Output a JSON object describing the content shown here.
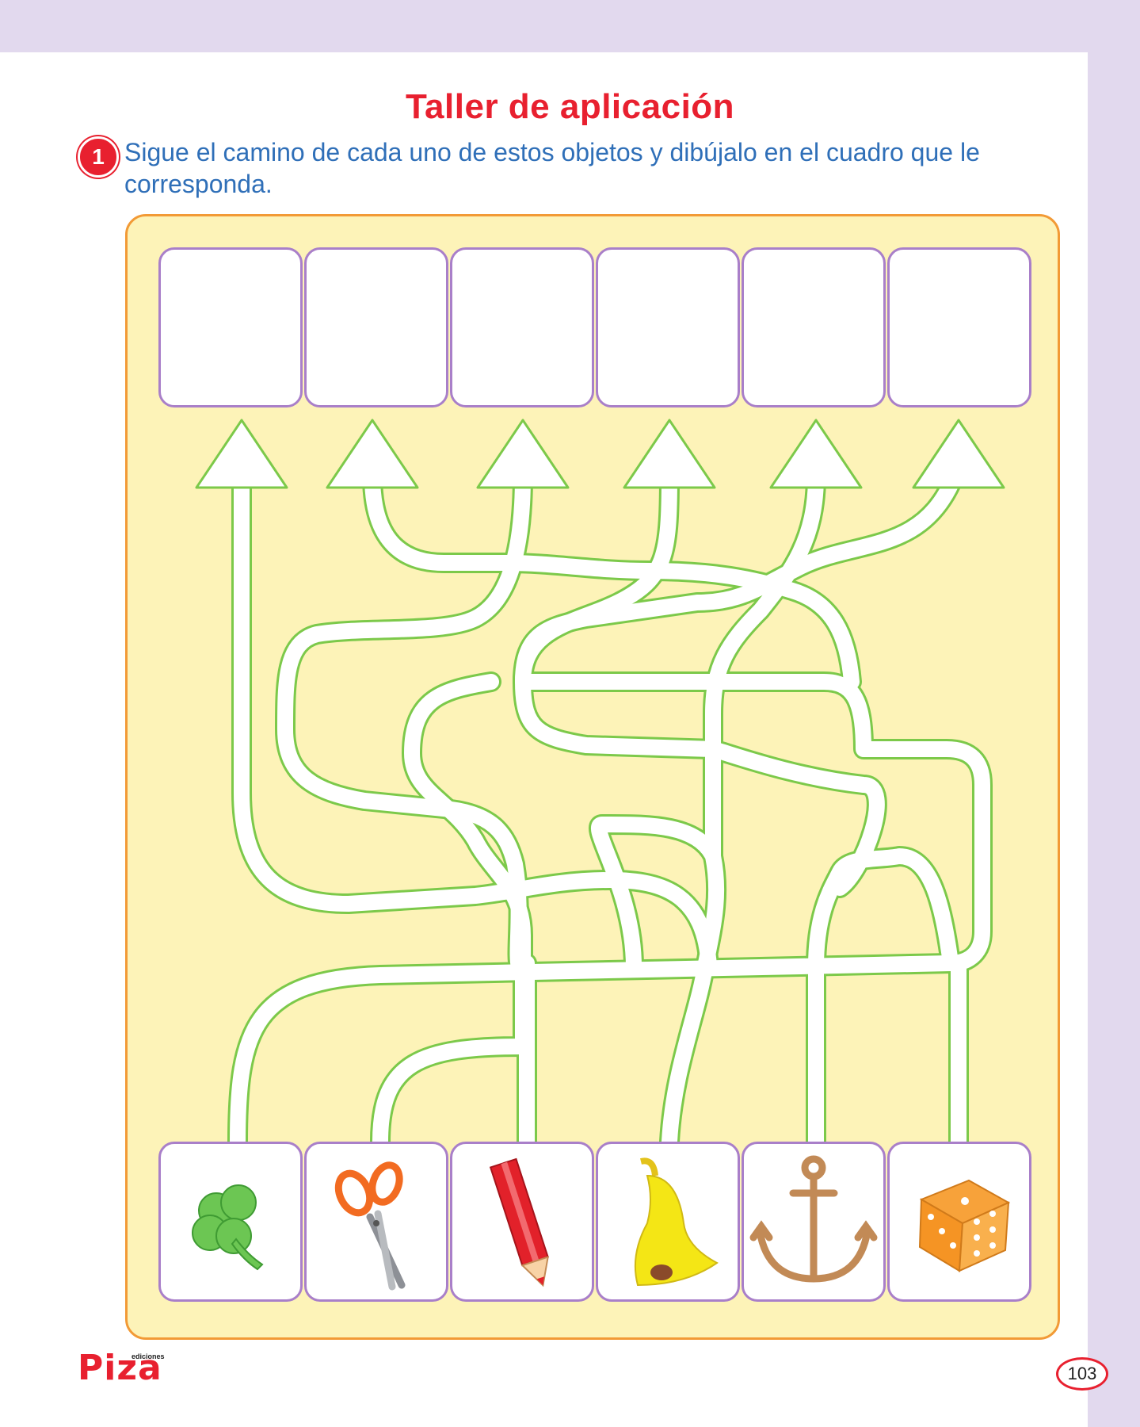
{
  "title": "Taller de aplicación",
  "exercise": {
    "number": "1",
    "instruction": "Sigue el camino de cada uno de estos objetos y dibújalo en el cuadro que le corresponda."
  },
  "objects": [
    {
      "icon": "clover-icon"
    },
    {
      "icon": "scissors-icon"
    },
    {
      "icon": "pencil-icon"
    },
    {
      "icon": "bell-icon"
    },
    {
      "icon": "anchor-icon"
    },
    {
      "icon": "dice-icon"
    }
  ],
  "colors": {
    "title": "#e8202f",
    "instruction": "#2f6fb8",
    "maze_background": "#fdf3b8",
    "frame_border": "#f29a36",
    "box_border": "#a97fc9",
    "path_stroke": "#7cc94a",
    "page_margin": "#e2d9ee"
  },
  "footer": {
    "brand": "Piza",
    "brand_sub": "ediciones",
    "page_number": "103"
  }
}
